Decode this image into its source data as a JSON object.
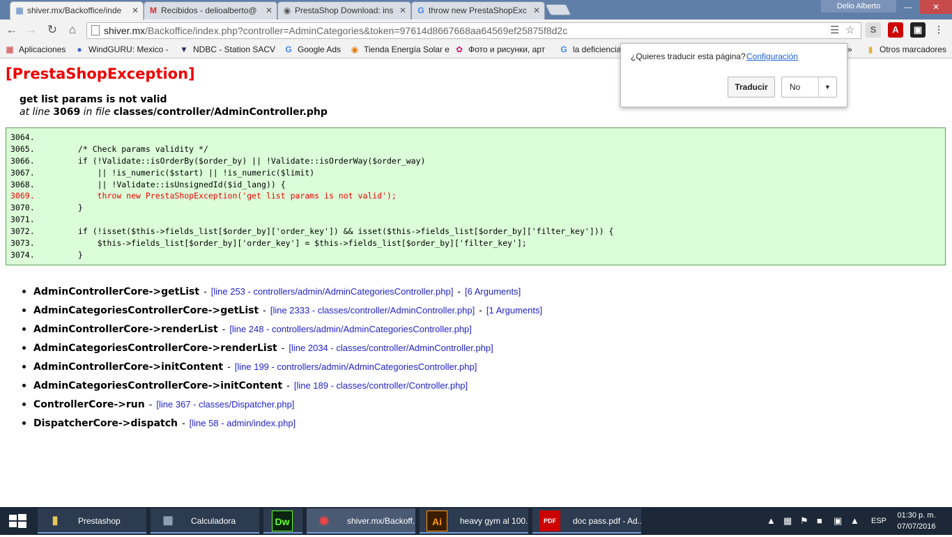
{
  "browser": {
    "tabs": [
      {
        "title": "shiver.mx/Backoffice/inde",
        "favicon": "page-icon",
        "active": true
      },
      {
        "title": "Recibidos - delioalberto@",
        "favicon": "gmail-icon",
        "active": false
      },
      {
        "title": "PrestaShop Download: ins",
        "favicon": "prestashop-icon",
        "active": false
      },
      {
        "title": "throw new PrestaShopExc",
        "favicon": "google-icon",
        "active": false
      }
    ],
    "profile": "Delio Alberto",
    "url_host": "shiver.mx",
    "url_rest": "/Backoffice/index.php?controller=AdminCategories&token=97614d8667668aa64569ef25875f8d2c",
    "bookmarks": [
      {
        "label": "Aplicaciones",
        "icon": "apps-grid-icon"
      },
      {
        "label": "WindGURU: Mexico -",
        "icon": "windguru-icon"
      },
      {
        "label": "NDBC - Station SACV",
        "icon": "ndbc-icon"
      },
      {
        "label": "Google Ads",
        "icon": "google-icon"
      },
      {
        "label": "Tienda Energía Solar e",
        "icon": "shop-icon"
      },
      {
        "label": "Фото и рисунки, арт",
        "icon": "art-icon"
      },
      {
        "label": "la deficiencia",
        "icon": "google-icon"
      }
    ],
    "bookmarks_more": "»",
    "other_bookmarks": "Otros marcadores"
  },
  "translate_bubble": {
    "question": "¿Quieres traducir esta página?",
    "config_link": "Configuración",
    "translate_button": "Traducir",
    "no_option": "No"
  },
  "exception": {
    "title": "[PrestaShopException]",
    "message": "get list params is not valid",
    "at_line_label": "at line",
    "line": "3069",
    "in_file_label": "in file",
    "file": "classes/controller/AdminController.php"
  },
  "code_lines": [
    {
      "text": "3064.",
      "error": false
    },
    {
      "text": "3065.         /* Check params validity */",
      "error": false
    },
    {
      "text": "3066.         if (!Validate::isOrderBy($order_by) || !Validate::isOrderWay($order_way)",
      "error": false
    },
    {
      "text": "3067.             || !is_numeric($start) || !is_numeric($limit)",
      "error": false
    },
    {
      "text": "3068.             || !Validate::isUnsignedId($id_lang)) {",
      "error": false
    },
    {
      "text": "3069.             throw new PrestaShopException('get list params is not valid');",
      "error": true
    },
    {
      "text": "3070.         }",
      "error": false
    },
    {
      "text": "3071.",
      "error": false
    },
    {
      "text": "3072.         if (!isset($this->fields_list[$order_by]['order_key']) && isset($this->fields_list[$order_by]['filter_key'])) {",
      "error": false
    },
    {
      "text": "3073.             $this->fields_list[$order_by]['order_key'] = $this->fields_list[$order_by]['filter_key'];",
      "error": false
    },
    {
      "text": "3074.         }",
      "error": false
    }
  ],
  "stack_trace": [
    {
      "fn": "AdminControllerCore->getList",
      "loc": "[line 253 - controllers/admin/AdminCategoriesController.php]",
      "args": "[6 Arguments]"
    },
    {
      "fn": "AdminCategoriesControllerCore->getList",
      "loc": "[line 2333 - classes/controller/AdminController.php]",
      "args": "[1 Arguments]"
    },
    {
      "fn": "AdminControllerCore->renderList",
      "loc": "[line 248 - controllers/admin/AdminCategoriesController.php]",
      "args": ""
    },
    {
      "fn": "AdminCategoriesControllerCore->renderList",
      "loc": "[line 2034 - classes/controller/AdminController.php]",
      "args": ""
    },
    {
      "fn": "AdminControllerCore->initContent",
      "loc": "[line 199 - controllers/admin/AdminCategoriesController.php]",
      "args": ""
    },
    {
      "fn": "AdminCategoriesControllerCore->initContent",
      "loc": "[line 189 - classes/controller/Controller.php]",
      "args": ""
    },
    {
      "fn": "ControllerCore->run",
      "loc": "[line 367 - classes/Dispatcher.php]",
      "args": ""
    },
    {
      "fn": "DispatcherCore->dispatch",
      "loc": "[line 58 - admin/index.php]",
      "args": ""
    }
  ],
  "separator": "-",
  "taskbar": {
    "items": [
      {
        "label": "Prestashop",
        "icon": "folder-icon",
        "active": false
      },
      {
        "label": "Calculadora",
        "icon": "calculator-icon",
        "active": false
      },
      {
        "label": "",
        "icon": "dreamweaver-icon",
        "active": false
      },
      {
        "label": "shiver.mx/Backoff...",
        "icon": "chrome-icon",
        "active": true
      },
      {
        "label": "heavy gym al 100...",
        "icon": "illustrator-icon",
        "active": false
      },
      {
        "label": "doc pass.pdf - Ad...",
        "icon": "pdf-icon",
        "active": false
      }
    ],
    "dw_text": "Dw",
    "ai_text": "Ai",
    "pdf_text": "PDF",
    "lang": "ESP",
    "time": "01:30 p. m.",
    "date": "07/07/2016"
  },
  "colors": {
    "error_red": "#ee0000",
    "code_bg": "#dbfdd8",
    "link_blue": "#2222cc",
    "taskbar": "#1c2838"
  }
}
